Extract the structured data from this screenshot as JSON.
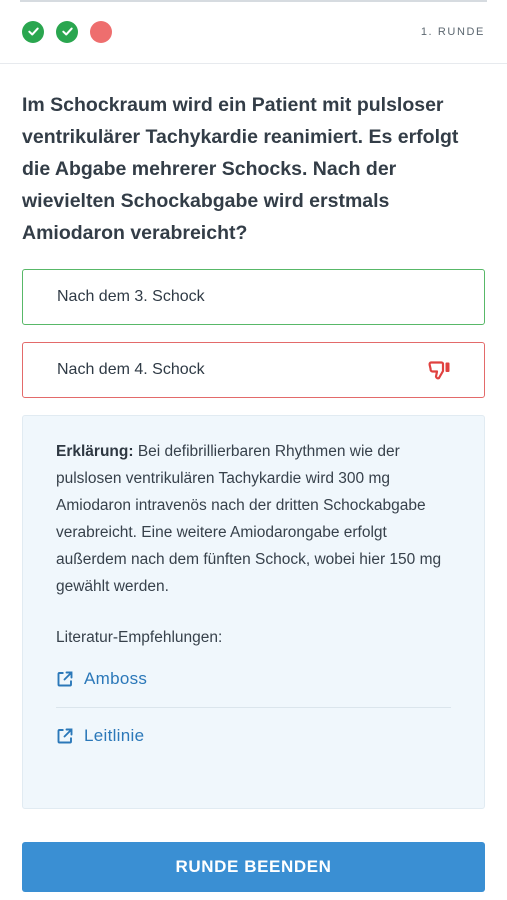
{
  "header": {
    "progress": [
      {
        "status": "correct",
        "icon": "check-icon"
      },
      {
        "status": "correct",
        "icon": "check-icon"
      },
      {
        "status": "wrong",
        "icon": "none"
      }
    ],
    "round_label": "1. RUNDE"
  },
  "question": "Im Schockraum wird ein Patient mit pulsloser ventrikulärer Tachykardie reanimiert. Es erfolgt die Abgabe mehrerer Schocks. Nach der wievielten Schockabgabe wird erstmals Amiodaron verabreicht?",
  "answers": [
    {
      "label": "Nach dem 3. Schock",
      "state": "correct"
    },
    {
      "label": "Nach dem 4. Schock",
      "state": "wrong",
      "icon": "thumbs-down-icon"
    }
  ],
  "explanation": {
    "heading": "Erklärung:",
    "text": "Bei defibrillierbaren Rhythmen wie der pulslosen ventrikulären Tachykardie wird 300 mg Amiodaron intravenös nach der dritten Schockabgabe verabreicht. Eine weitere Amiodarongabe erfolgt außerdem nach dem fünften Schock, wobei hier 150 mg gewählt werden.",
    "literature_label": "Literatur-Empfehlungen:",
    "links": [
      {
        "label": "Amboss",
        "icon": "external-link-icon"
      },
      {
        "label": "Leitlinie",
        "icon": "external-link-icon"
      }
    ]
  },
  "cta": {
    "label": "RUNDE BEENDEN"
  },
  "colors": {
    "correct": "#2aa64f",
    "wrong": "#ee6e6e",
    "primary": "#3a8fd3",
    "link": "#2b78b9"
  }
}
